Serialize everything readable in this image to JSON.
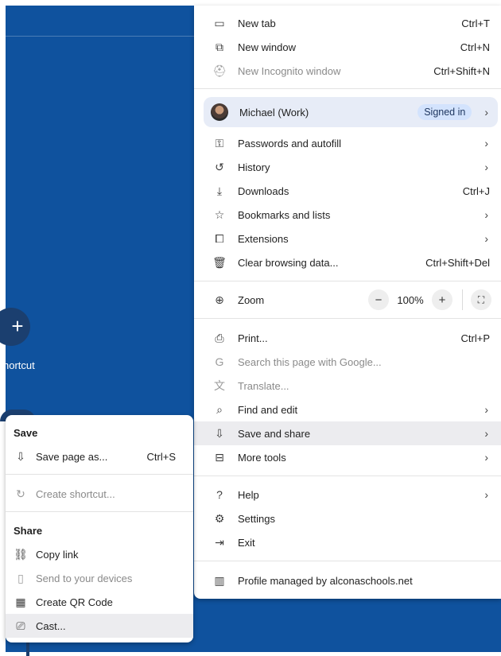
{
  "background": {
    "shortcut_plus": "+",
    "shortcut_label": "hortcut"
  },
  "menu": {
    "items_top": [
      {
        "label": "New tab",
        "shortcut": "Ctrl+T",
        "icon": "new-tab-icon",
        "glyph": "▭"
      },
      {
        "label": "New window",
        "shortcut": "Ctrl+N",
        "icon": "new-window-icon",
        "glyph": "⧉"
      },
      {
        "label": "New Incognito window",
        "shortcut": "Ctrl+Shift+N",
        "icon": "incognito-icon",
        "glyph": "⛑"
      }
    ],
    "profile": {
      "name": "Michael (Work)",
      "badge": "Signed in",
      "chevron": "›"
    },
    "items_mid": [
      {
        "label": "Passwords and autofill",
        "chevron": "›",
        "icon": "key-icon",
        "glyph": "⚿"
      },
      {
        "label": "History",
        "chevron": "›",
        "icon": "history-icon",
        "glyph": "↺"
      },
      {
        "label": "Downloads",
        "shortcut": "Ctrl+J",
        "icon": "download-icon",
        "glyph": "⤓"
      },
      {
        "label": "Bookmarks and lists",
        "chevron": "›",
        "icon": "star-icon",
        "glyph": "☆"
      },
      {
        "label": "Extensions",
        "chevron": "›",
        "icon": "puzzle-icon",
        "glyph": "⧠"
      },
      {
        "label": "Clear browsing data...",
        "shortcut": "Ctrl+Shift+Del",
        "icon": "trash-icon",
        "glyph": "🗑"
      }
    ],
    "zoom": {
      "label": "Zoom",
      "minus": "−",
      "value": "100%",
      "plus": "+",
      "fullscreen": "⛶",
      "icon": "zoom-icon",
      "glyph": "⊕"
    },
    "items_tools": [
      {
        "label": "Print...",
        "shortcut": "Ctrl+P",
        "icon": "print-icon",
        "glyph": "⎙"
      },
      {
        "label": "Search this page with Google...",
        "icon": "google-icon",
        "glyph": "G"
      },
      {
        "label": "Translate...",
        "icon": "translate-icon",
        "glyph": "文"
      },
      {
        "label": "Find and edit",
        "chevron": "›",
        "icon": "find-icon",
        "glyph": "⌕"
      },
      {
        "label": "Save and share",
        "chevron": "›",
        "icon": "save-share-icon",
        "glyph": "⇩"
      },
      {
        "label": "More tools",
        "chevron": "›",
        "icon": "toolbox-icon",
        "glyph": "⊟"
      }
    ],
    "items_help": [
      {
        "label": "Help",
        "chevron": "›",
        "icon": "help-icon",
        "glyph": "?"
      },
      {
        "label": "Settings",
        "icon": "gear-icon",
        "glyph": "⚙"
      },
      {
        "label": "Exit",
        "icon": "exit-icon",
        "glyph": "⇥"
      }
    ],
    "managed": {
      "label": "Profile managed by alconaschools.net",
      "icon": "building-icon",
      "glyph": "▥"
    }
  },
  "submenu": {
    "save_heading": "Save",
    "save_page": {
      "label": "Save page as...",
      "shortcut": "Ctrl+S",
      "glyph": "⇩"
    },
    "create_shortcut": {
      "label": "Create shortcut...",
      "glyph": "↻"
    },
    "share_heading": "Share",
    "share_items": [
      {
        "label": "Copy link",
        "icon": "link-icon",
        "glyph": "⛓"
      },
      {
        "label": "Send to your devices",
        "icon": "devices-icon",
        "glyph": "▯"
      },
      {
        "label": "Create QR Code",
        "icon": "qr-code-icon",
        "glyph": "▦"
      },
      {
        "label": "Cast...",
        "icon": "cast-icon",
        "glyph": "⎚"
      }
    ]
  }
}
